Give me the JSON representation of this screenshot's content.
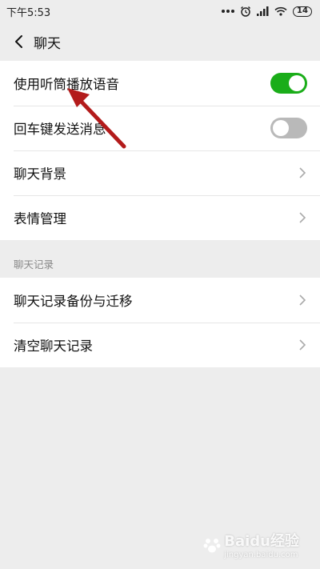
{
  "status_bar": {
    "time": "下午5:53",
    "battery": "14"
  },
  "header": {
    "title": "聊天"
  },
  "settings": [
    {
      "label": "使用听筒播放语音",
      "control": "toggle",
      "on": true
    },
    {
      "label": "回车键发送消息",
      "control": "toggle",
      "on": false
    },
    {
      "label": "聊天背景",
      "control": "chevron"
    },
    {
      "label": "表情管理",
      "control": "chevron"
    }
  ],
  "history_section": {
    "label": "聊天记录",
    "items": [
      {
        "label": "聊天记录备份与迁移"
      },
      {
        "label": "清空聊天记录"
      }
    ]
  },
  "watermark": {
    "brand": "Bai",
    "brand_mid": "du",
    "text": "经验",
    "url": "jingyan.baidu.com"
  },
  "colors": {
    "toggle_on": "#1aad19",
    "toggle_off": "#b9b9b9",
    "annotation_arrow": "#b31b1b"
  }
}
